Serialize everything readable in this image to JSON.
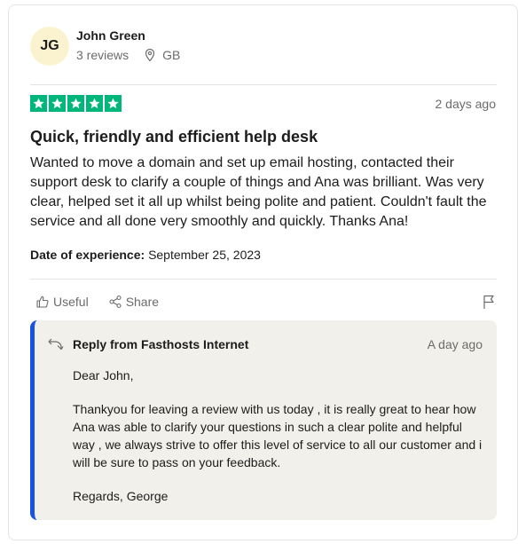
{
  "reviewer": {
    "initials": "JG",
    "name": "John Green",
    "reviews": "3 reviews",
    "country": "GB"
  },
  "review": {
    "rating": 5,
    "rating_color": "#00b67a",
    "date_ago": "2 days ago",
    "title": "Quick, friendly and efficient help desk",
    "body": "Wanted to move a domain and set up email hosting, contacted their support desk to clarify a couple of things and Ana was brilliant. Was very clear, helped set it all up whilst being polite and patient. Couldn't fault the service and all done very smoothly and quickly. Thanks Ana!",
    "experience_label": "Date of experience:",
    "experience_date": "September 25, 2023"
  },
  "actions": {
    "useful": "Useful",
    "share": "Share"
  },
  "reply": {
    "title": "Reply from Fasthosts Internet",
    "date_ago": "A day ago",
    "accent_color": "#1852e0",
    "greeting": "Dear John,",
    "paragraph": "Thankyou for leaving a review with us today , it is really great to hear how Ana was able to clarify your questions in such a clear polite and helpful way , we always strive to offer this level of service to all our customer and i will be sure to pass on your feedback.",
    "signoff": "Regards, George"
  },
  "icons": [
    "location-pin-icon",
    "star-icon",
    "thumbs-up-icon",
    "share-icon",
    "flag-icon",
    "reply-arrow-icon"
  ]
}
